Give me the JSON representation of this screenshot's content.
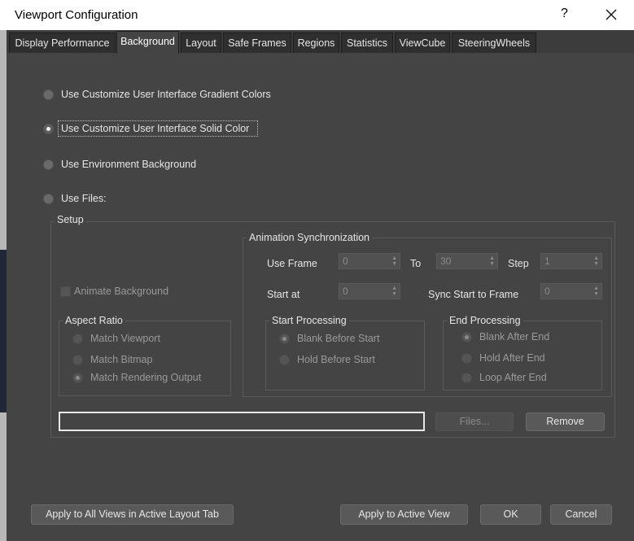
{
  "window": {
    "title": "Viewport Configuration",
    "help_label": "?"
  },
  "tabs": [
    {
      "label": "Display Performance"
    },
    {
      "label": "Background"
    },
    {
      "label": "Layout"
    },
    {
      "label": "Safe Frames"
    },
    {
      "label": "Regions"
    },
    {
      "label": "Statistics"
    },
    {
      "label": "ViewCube"
    },
    {
      "label": "SteeringWheels"
    }
  ],
  "active_tab": "Background",
  "background_options": [
    {
      "label": "Use Customize User Interface Gradient Colors",
      "checked": false
    },
    {
      "label": "Use Customize User Interface Solid Color",
      "checked": true
    },
    {
      "label": "Use Environment Background",
      "checked": false
    },
    {
      "label": "Use Files:",
      "checked": false
    }
  ],
  "setup": {
    "label": "Setup",
    "animate_background": "Animate Background",
    "aspect_ratio": {
      "label": "Aspect Ratio",
      "options": [
        {
          "label": "Match Viewport",
          "checked": false
        },
        {
          "label": "Match Bitmap",
          "checked": false
        },
        {
          "label": "Match Rendering Output",
          "checked": true
        }
      ]
    },
    "animation_sync": {
      "label": "Animation Synchronization",
      "use_frame_label": "Use Frame",
      "use_frame_value": "0",
      "to_label": "To",
      "to_value": "30",
      "step_label": "Step",
      "step_value": "1",
      "start_at_label": "Start at",
      "start_at_value": "0",
      "sync_label": "Sync Start to Frame",
      "sync_value": "0",
      "start_processing": {
        "label": "Start Processing",
        "options": [
          {
            "label": "Blank Before Start",
            "checked": true
          },
          {
            "label": "Hold Before Start",
            "checked": false
          }
        ]
      },
      "end_processing": {
        "label": "End Processing",
        "options": [
          {
            "label": "Blank After End",
            "checked": true
          },
          {
            "label": "Hold After End",
            "checked": false
          },
          {
            "label": "Loop After End",
            "checked": false
          }
        ]
      }
    },
    "file_path": "",
    "files_button": "Files...",
    "remove_button": "Remove"
  },
  "footer": {
    "apply_all": "Apply to All Views in Active Layout Tab",
    "apply_active": "Apply to Active View",
    "ok": "OK",
    "cancel": "Cancel"
  }
}
